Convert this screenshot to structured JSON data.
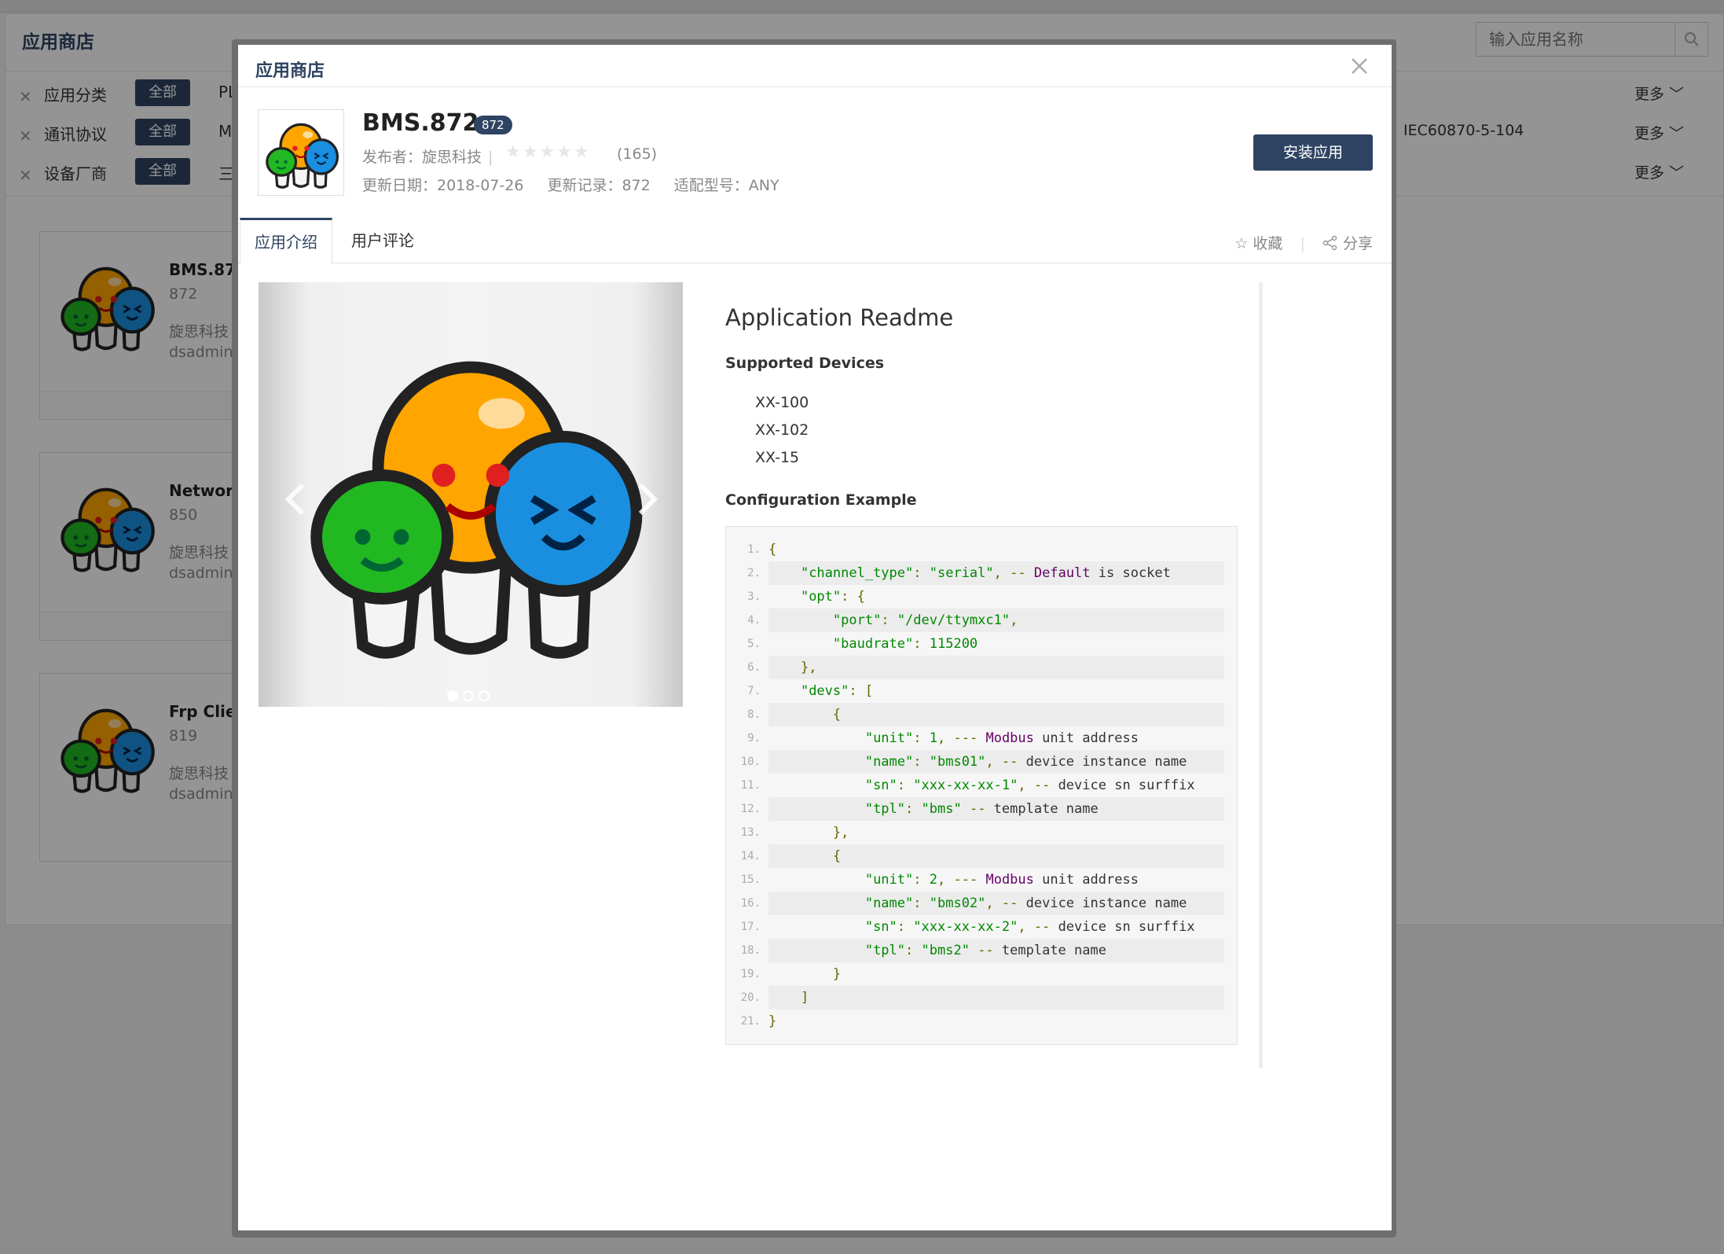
{
  "background": {
    "title": "应用商店",
    "search_placeholder": "输入应用名称",
    "filters": [
      {
        "label": "应用分类",
        "active": "全部",
        "first": "PL",
        "extra": "",
        "more": "更多"
      },
      {
        "label": "通讯协议",
        "active": "全部",
        "first": "M",
        "extra": "IEC60870-5-104",
        "more": "更多"
      },
      {
        "label": "设备厂商",
        "active": "全部",
        "first": "三",
        "extra": "",
        "more": "更多"
      }
    ],
    "cards": [
      {
        "name": "BMS.87",
        "version": "872",
        "publisher": "旋思科技",
        "email": "dsadmin@"
      },
      {
        "name": "Networl",
        "version": "850",
        "publisher": "旋思科技",
        "email": "dsadmin@"
      },
      {
        "name": "Frp Clie",
        "version": "819",
        "publisher": "旋思科技",
        "email": "dsadmin@"
      }
    ]
  },
  "modal": {
    "title": "应用商店",
    "app": {
      "name": "BMS.872",
      "badge": "872",
      "publisher_label": "发布者：旋思科技",
      "rating_count": "(165)",
      "rating": 0,
      "update_date": "更新日期：2018-07-26",
      "update_record": "更新记录：872",
      "model": "适配型号：ANY"
    },
    "install_label": "安装应用",
    "tabs": [
      "应用介绍",
      "用户评论"
    ],
    "favorite_label": "收藏",
    "share_label": "分享",
    "carousel": {
      "slides": 3,
      "active": 0
    },
    "readme": {
      "title": "Application Readme",
      "devices_heading": "Supported Devices",
      "devices": [
        "XX-100",
        "XX-102",
        "XX-15"
      ],
      "config_heading": "Configuration Example",
      "code_lines": [
        "{",
        "    \"channel_type\": \"serial\", -- Default is socket",
        "    \"opt\": {",
        "        \"port\": \"/dev/ttymxc1\",",
        "        \"baudrate\": 115200",
        "    },",
        "    \"devs\": [",
        "        {",
        "            \"unit\": 1, --- Modbus unit address",
        "            \"name\": \"bms01\", -- device instance name",
        "            \"sn\": \"xxx-xx-xx-1\", -- device sn surffix",
        "            \"tpl\": \"bms\" -- template name",
        "        },",
        "        {",
        "            \"unit\": 2, --- Modbus unit address",
        "            \"name\": \"bms02\", -- device instance name",
        "            \"sn\": \"xxx-xx-xx-2\", -- device sn surffix",
        "            \"tpl\": \"bms2\" -- template name",
        "        }",
        "    ]",
        "}"
      ]
    }
  },
  "colors": {
    "brand": "#2f4463",
    "accent_orange": "#ff9900",
    "accent_green": "#22bb22",
    "accent_blue": "#1a90e0"
  }
}
